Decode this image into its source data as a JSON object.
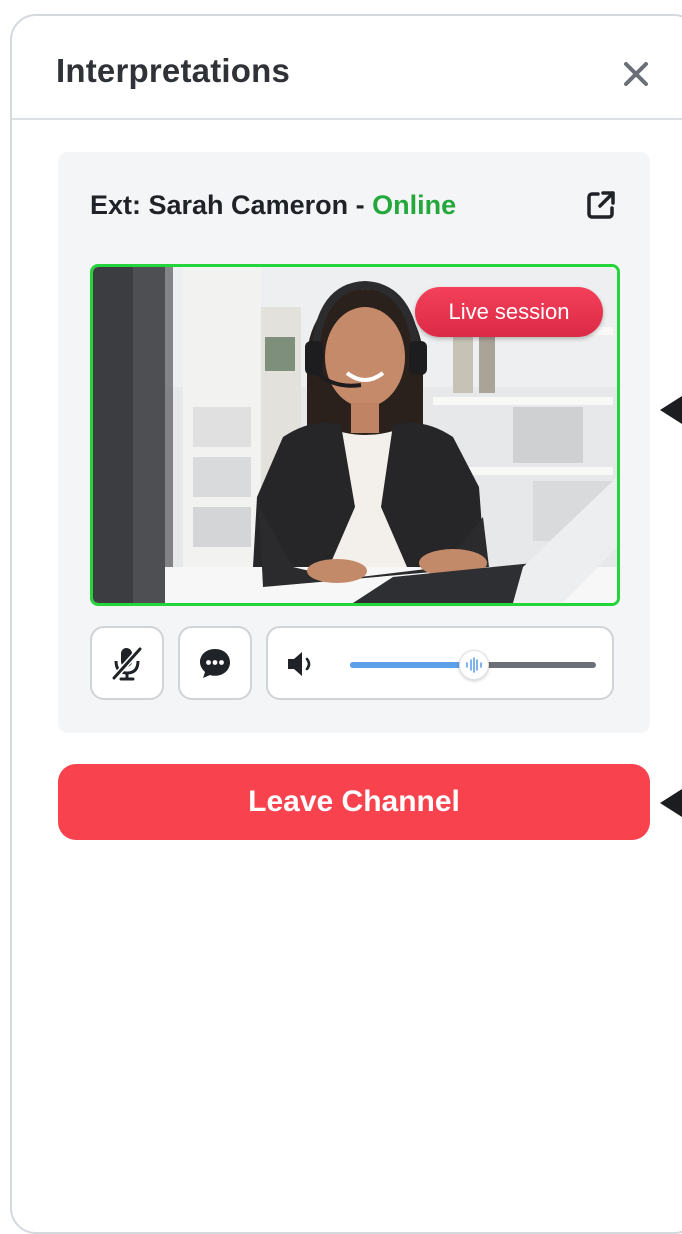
{
  "panel": {
    "title": "Interpretations",
    "close_icon": "close-icon"
  },
  "session_card": {
    "caller_prefix": "Ext: Sarah Cameron - ",
    "caller_status": "Online",
    "status_color": "#24a83c",
    "popout_icon": "external-link-icon",
    "video": {
      "badge": "Live session",
      "border_color": "#23d43a",
      "badge_color": "#e8334f"
    },
    "controls": {
      "mute_icon": "microphone-muted-icon",
      "chat_icon": "chat-bubble-icon",
      "volume_icon": "speaker-icon",
      "volume_level": 0.5
    }
  },
  "actions": {
    "leave_label": "Leave Channel",
    "leave_color": "#f8434f"
  }
}
